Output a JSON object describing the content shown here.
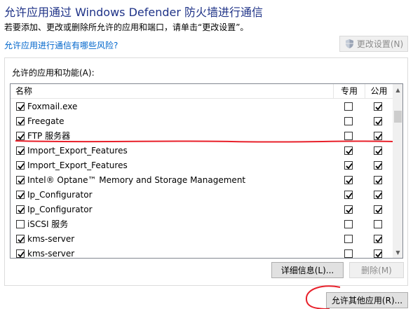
{
  "header": {
    "title": "允许应用通过 Windows Defender 防火墙进行通信",
    "description": "若要添加、更改或删除所允许的应用和端口，请单击“更改设置”。",
    "risk_link": "允许应用进行通信有哪些风险?",
    "change_settings_label": "更改设置(N)"
  },
  "apps_group": {
    "label": "允许的应用和功能(A):",
    "columns": {
      "name": "名称",
      "private": "专用",
      "public": "公用"
    },
    "rows": [
      {
        "name": "Foxmail.exe",
        "enabled": true,
        "private": false,
        "public": true
      },
      {
        "name": "Freegate",
        "enabled": true,
        "private": false,
        "public": true
      },
      {
        "name": "FTP 服务器",
        "enabled": true,
        "private": false,
        "public": true
      },
      {
        "name": "Import_Export_Features",
        "enabled": true,
        "private": true,
        "public": true
      },
      {
        "name": "Import_Export_Features",
        "enabled": true,
        "private": true,
        "public": true
      },
      {
        "name": "Intel® Optane™ Memory and Storage Management",
        "enabled": true,
        "private": true,
        "public": true
      },
      {
        "name": "Ip_Configurator",
        "enabled": true,
        "private": true,
        "public": true
      },
      {
        "name": "Ip_Configurator",
        "enabled": true,
        "private": true,
        "public": true
      },
      {
        "name": "iSCSI 服务",
        "enabled": false,
        "private": false,
        "public": false
      },
      {
        "name": "kms-server",
        "enabled": true,
        "private": false,
        "public": true
      },
      {
        "name": "kms-server",
        "enabled": true,
        "private": false,
        "public": true
      }
    ],
    "details_label": "详细信息(L)...",
    "delete_label": "删除(M)"
  },
  "footer": {
    "allow_other_label": "允许其他应用(R)..."
  },
  "colors": {
    "title": "#1e3287",
    "link": "#0066cc",
    "annotation_red": "#e8202a"
  }
}
